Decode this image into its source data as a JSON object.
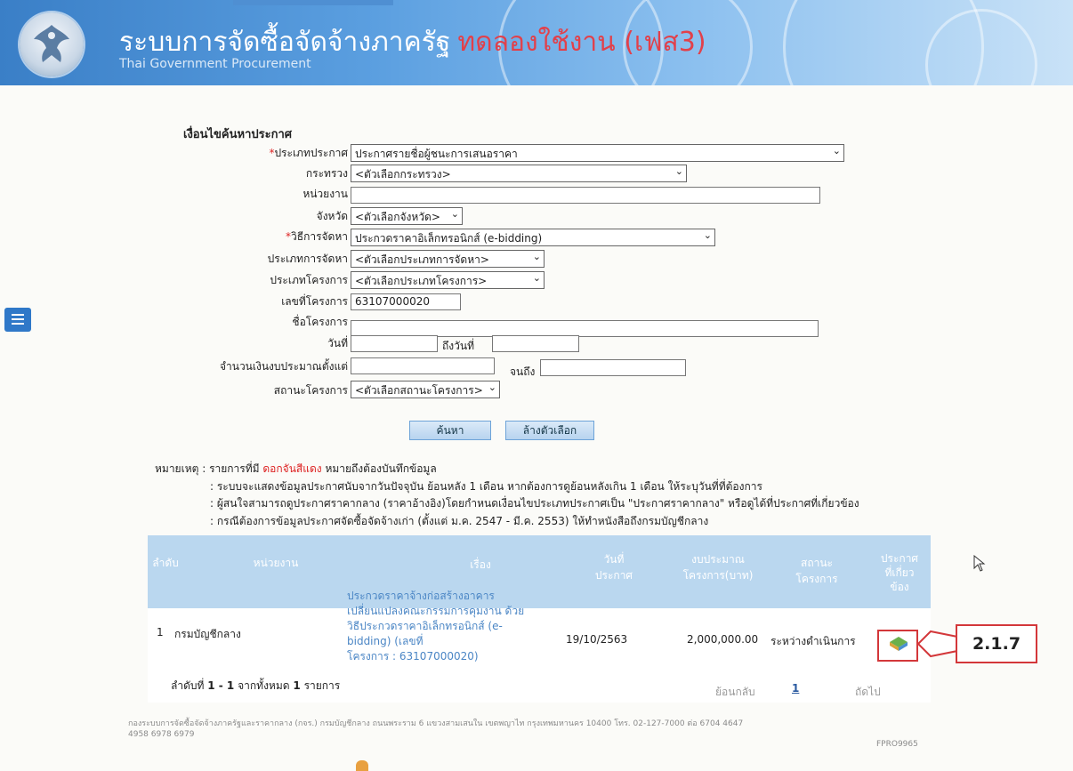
{
  "header": {
    "title": "ระบบการจัดซื้อจัดจ้างภาครัฐ",
    "trial_label": "ทดลองใช้งาน (เฟส3)",
    "subtitle": "Thai Government Procurement"
  },
  "form": {
    "section_title": "เงื่อนไขค้นหาประกาศ",
    "announcement_type": {
      "label": "ประเภทประกาศ",
      "value": "ประกาศรายชื่อผู้ชนะการเสนอราคา"
    },
    "ministry": {
      "label": "กระทรวง",
      "value": "<ตัวเลือกกระทรวง>"
    },
    "agency": {
      "label": "หน่วยงาน",
      "value": ""
    },
    "province": {
      "label": "จังหวัด",
      "value": "<ตัวเลือกจังหวัด>"
    },
    "method": {
      "label": "วิธีการจัดหา",
      "value": "ประกวดราคาอิเล็กทรอนิกส์ (e-bidding)"
    },
    "procurement_type": {
      "label": "ประเภทการจัดหา",
      "value": "<ตัวเลือกประเภทการจัดหา>"
    },
    "project_type": {
      "label": "ประเภทโครงการ",
      "value": "<ตัวเลือกประเภทโครงการ>"
    },
    "project_no": {
      "label": "เลขที่โครงการ",
      "value": "63107000020"
    },
    "project_name": {
      "label": "ชื่อโครงการ",
      "value": ""
    },
    "date_from": {
      "label": "วันที่",
      "value": ""
    },
    "date_to": {
      "label": "ถึงวันที่",
      "value": ""
    },
    "budget_from": {
      "label": "จำนวนเงินงบประมาณตั้งแต่",
      "value": ""
    },
    "budget_to": {
      "label": "จนถึง",
      "value": ""
    },
    "status": {
      "label": "สถานะโครงการ",
      "value": "<ตัวเลือกสถานะโครงการ>"
    },
    "search_button": "ค้นหา",
    "clear_button": "ล้างตัวเลือก"
  },
  "notes": {
    "prefix": "หมายเหตุ : รายการที่มี",
    "red": "ดอกจันสีแดง",
    "suffix": "หมายถึงต้องบันทึกข้อมูล",
    "line2": ": ระบบจะแสดงข้อมูลประกาศนับจากวันปัจจุบัน ย้อนหลัง 1 เดือน หากต้องการดูย้อนหลังเกิน 1 เดือน ให้ระบุวันที่ที่ต้องการ",
    "line3": ": ผู้สนใจสามารถดูประกาศราคากลาง (ราคาอ้างอิง)โดยกำหนดเงื่อนไขประเภทประกาศเป็น \"ประกาศราคากลาง\" หรือดูได้ที่ประกาศที่เกี่ยวข้อง",
    "line4": ": กรณีต้องการข้อมูลประกาศจัดซื้อจัดจ้างเก่า (ตั้งแต่ ม.ค. 2547 - มี.ค. 2553) ให้ทำหนังสือถึงกรมบัญชีกลาง"
  },
  "table": {
    "headers": {
      "no": "ลำดับ",
      "agency": "หน่วยงาน",
      "subject": "เรื่อง",
      "date_l1": "วันที่",
      "date_l2": "ประกาศ",
      "budget_l1": "งบประมาณ",
      "budget_l2": "โครงการ(บาท)",
      "status_l1": "สถานะ",
      "status_l2": "โครงการ",
      "related_l1": "ประกาศ",
      "related_l2": "ที่เกี่ยว",
      "related_l3": "ข้อง"
    },
    "row": {
      "no": "1",
      "agency": "กรมบัญชีกลาง",
      "subject_l1": "ประกวดราคาจ้างก่อสร้างอาคาร",
      "subject_l2": "เปลี่ยนแปลงคณะกรรมการคุมงาน ด้วย",
      "subject_l3": "วิธีประกวดราคาอิเล็กทรอนิกส์ (e-",
      "subject_l4": "bidding) (เลขที่",
      "subject_l5": "โครงการ : 63107000020)",
      "date": "19/10/2563",
      "budget": "2,000,000.00",
      "status": "ระหว่างดำเนินการ"
    },
    "summary_prefix": "ลำดับที่",
    "summary_range": "1 - 1",
    "summary_mid": "จากทั้งหมด",
    "summary_total": "1",
    "summary_unit": "รายการ",
    "prev": "ย้อนกลับ",
    "page": "1",
    "next": "ถัดไป"
  },
  "footer": {
    "line1": "กองระบบการจัดซื้อจัดจ้างภาครัฐและราคากลาง (กจร.) กรมบัญชีกลาง ถนนพระราม 6 แขวงสามเสนใน เขตพญาไท กรุงเทพมหานคร 10400 โทร. 02-127-7000 ต่อ 6704 4647",
    "line2": "4958 6978 6979",
    "code": "FPRO9965"
  },
  "annotation": {
    "label": "2.1.7",
    "color": "#d3373a"
  },
  "colors": {
    "header_blue": "#3a7fc7",
    "table_head": "#bad7ef",
    "link": "#4b86c5",
    "required": "#d22222"
  }
}
